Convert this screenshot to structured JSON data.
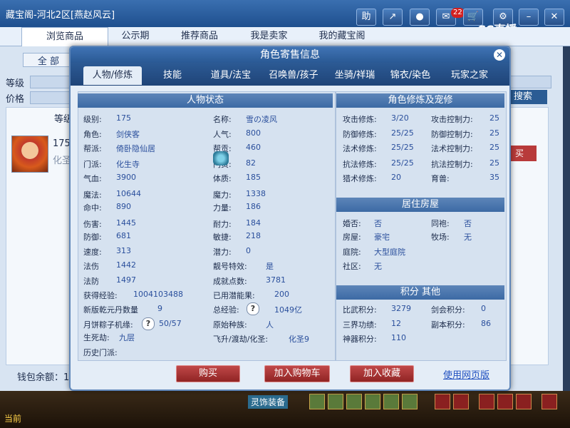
{
  "window": {
    "title": "藏宝阁-河北2区[燕赵风云]"
  },
  "toolbar": {
    "help": "助",
    "share": "↗",
    "record": "●",
    "chat_badge": "22",
    "close": "✕",
    "gear": "⚙",
    "logo": "CC直播"
  },
  "bg_tabs": [
    "浏览商品",
    "公示期",
    "推荐商品",
    "我是卖家",
    "我的藏宝阁"
  ],
  "bg": {
    "all_btn": "全 部",
    "level_label": "等级",
    "price_label": "价格",
    "search_btn": "搜索",
    "col_head": "等级",
    "item_level": "175",
    "item_school": "化圣",
    "buy_btn": "买",
    "wallet": "钱包余额：1",
    "game_bottom": [
      "当前",
      "灵饰装备"
    ]
  },
  "modal": {
    "title": "角色寄售信息",
    "close": "✕",
    "tabs": [
      "人物/修炼",
      "技能",
      "道具/法宝",
      "召唤兽/孩子",
      "坐骑/祥瑞",
      "锦衣/染色",
      "玩家之家"
    ],
    "status_title": "人物状态",
    "status_left": [
      {
        "label": "级别:",
        "value": "175"
      },
      {
        "label": "角色:",
        "value": "剑侠客"
      },
      {
        "label": "帮派:",
        "value": "倚卧隐仙居"
      },
      {
        "label": "门派:",
        "value": "化生寺"
      },
      {
        "label": "气血:",
        "value": "3900"
      },
      {
        "label": "魔法:",
        "value": "10644"
      },
      {
        "label": "命中:",
        "value": "890"
      },
      {
        "label": "伤害:",
        "value": "1445"
      },
      {
        "label": "防御:",
        "value": "681"
      },
      {
        "label": "速度:",
        "value": "313"
      },
      {
        "label": "法伤",
        "value": "1442"
      },
      {
        "label": "法防",
        "value": "1497"
      },
      {
        "label": "获得经验:",
        "value": "1004103488"
      },
      {
        "label": "新版乾元丹数量",
        "value": "9"
      },
      {
        "label": "月饼粽子机缘:",
        "value": "50/57"
      },
      {
        "label": "生死劫:",
        "value": "九层"
      },
      {
        "label": "历史门派:",
        "value": ""
      }
    ],
    "status_right": [
      {
        "label": "名称:",
        "value": "雪の凌风"
      },
      {
        "label": "人气:",
        "value": "800"
      },
      {
        "label": "帮贡:",
        "value": "460"
      },
      {
        "label": "门贡:",
        "value": "82"
      },
      {
        "label": "体质:",
        "value": "185"
      },
      {
        "label": "魔力:",
        "value": "1338"
      },
      {
        "label": "力量:",
        "value": "186"
      },
      {
        "label": "耐力:",
        "value": "184"
      },
      {
        "label": "敏捷:",
        "value": "218"
      },
      {
        "label": "潜力:",
        "value": "0"
      },
      {
        "label": "靓号特效:",
        "value": "是"
      },
      {
        "label": "成就点数:",
        "value": "3781"
      },
      {
        "label": "已用潜能果:",
        "value": "200"
      },
      {
        "label": "总经验:",
        "value": "1049亿"
      },
      {
        "label": "原始种族:",
        "value": "人"
      },
      {
        "label": "飞升/渡劫/化圣:",
        "value": "化圣9"
      }
    ],
    "cultivation_title": "角色修炼及宠修",
    "cultivation": [
      {
        "label": "攻击修炼:",
        "value": "3/20",
        "label2": "攻击控制力:",
        "value2": "25"
      },
      {
        "label": "防御修炼:",
        "value": "25/25",
        "label2": "防御控制力:",
        "value2": "25"
      },
      {
        "label": "法术修炼:",
        "value": "25/25",
        "label2": "法术控制力:",
        "value2": "25"
      },
      {
        "label": "抗法修炼:",
        "value": "25/25",
        "label2": "抗法控制力:",
        "value2": "25"
      },
      {
        "label": "猎术修炼:",
        "value": "20",
        "label2": "育兽:",
        "value2": "35"
      }
    ],
    "house_title": "居住房屋",
    "house": [
      {
        "label": "婚否:",
        "value": "否",
        "label2": "同袍:",
        "value2": "否"
      },
      {
        "label": "房屋:",
        "value": "豪宅",
        "label2": "牧场:",
        "value2": "无"
      },
      {
        "label": "庭院:",
        "value": "大型庭院"
      },
      {
        "label": "社区:",
        "value": "无"
      }
    ],
    "score_title": "积分 其他",
    "score": [
      {
        "label": "比武积分:",
        "value": "3279",
        "label2": "剑会积分:",
        "value2": "0"
      },
      {
        "label": "三界功绩:",
        "value": "12",
        "label2": "副本积分:",
        "value2": "86"
      },
      {
        "label": "神器积分:",
        "value": "110"
      }
    ],
    "buttons": {
      "buy": "购买",
      "add_cart": "加入购物车",
      "add_fav": "加入收藏",
      "web": "使用网页版"
    }
  }
}
